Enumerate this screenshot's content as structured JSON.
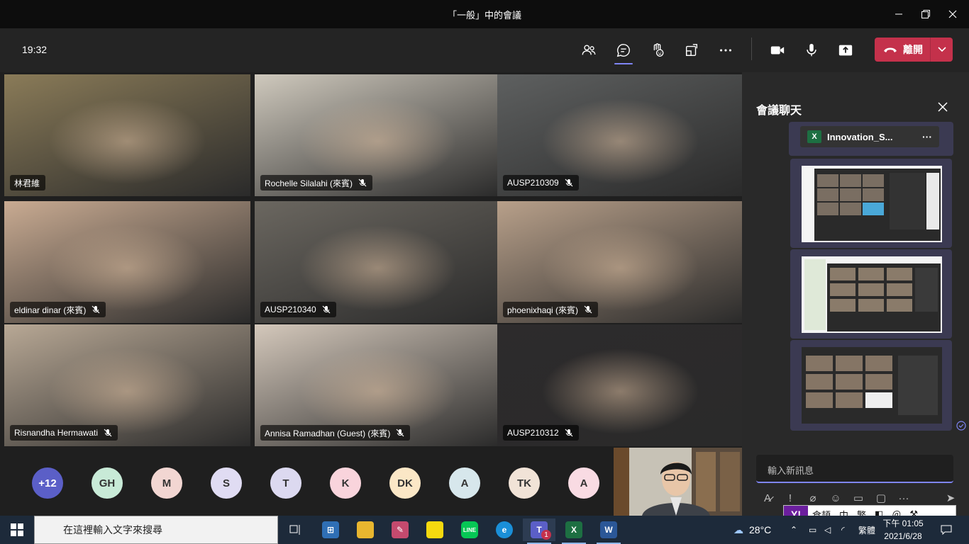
{
  "window": {
    "title": "「一般」中的會議"
  },
  "toolbar": {
    "time": "19:32",
    "leave_label": "離開"
  },
  "tiles": [
    {
      "name": "林君維",
      "muted": false,
      "color": "#8a7b58"
    },
    {
      "name": "Rochelle Silalahi (來賓)",
      "muted": true,
      "color": "#cfc9bd"
    },
    {
      "name": "AUSP210309",
      "muted": true,
      "color": "#5e6060"
    },
    {
      "name": "eldinar dinar (來賓)",
      "muted": true,
      "color": "#c9ab92"
    },
    {
      "name": "AUSP210340",
      "muted": true,
      "color": "#6b6760"
    },
    {
      "name": "phoenixhaqi (來賓)",
      "muted": true,
      "color": "#b8a08a"
    },
    {
      "name": "Risnandha Hermawati",
      "muted": true,
      "color": "#b8a895"
    },
    {
      "name": "Annisa Ramadhan (Guest) (來賓)",
      "muted": true,
      "color": "#d4c8bb"
    },
    {
      "name": "AUSP210312",
      "muted": true,
      "color": "#2d2b2c"
    }
  ],
  "avatars": [
    {
      "initials": "+12",
      "color": "#5b5fc7",
      "text": "#ffffff"
    },
    {
      "initials": "GH",
      "color": "#c8ead7",
      "text": "#333333"
    },
    {
      "initials": "M",
      "color": "#f2d6d2",
      "text": "#333333"
    },
    {
      "initials": "S",
      "color": "#e0dcf3",
      "text": "#333333"
    },
    {
      "initials": "T",
      "color": "#dcd9f0",
      "text": "#333333"
    },
    {
      "initials": "K",
      "color": "#f9d4dc",
      "text": "#333333"
    },
    {
      "initials": "DK",
      "color": "#fbe7c6",
      "text": "#333333"
    },
    {
      "initials": "A",
      "color": "#d7e7ec",
      "text": "#333333"
    },
    {
      "initials": "TK",
      "color": "#f1e3d7",
      "text": "#333333"
    },
    {
      "initials": "A",
      "color": "#f9dbe3",
      "text": "#333333"
    }
  ],
  "chat": {
    "header": "會議聊天",
    "file_name": "Innovation_S...",
    "input_placeholder": "輸入新訊息"
  },
  "ime": {
    "logo": "Y!",
    "mode": "倉頡",
    "lang": "中",
    "script": "繁"
  },
  "taskbar": {
    "search_placeholder": "在這裡輸入文字來搜尋",
    "weather": "28°C",
    "ime_indicator": "繁體",
    "time": "下午 01:05",
    "date": "2021/6/28",
    "teams_badge": "1"
  }
}
